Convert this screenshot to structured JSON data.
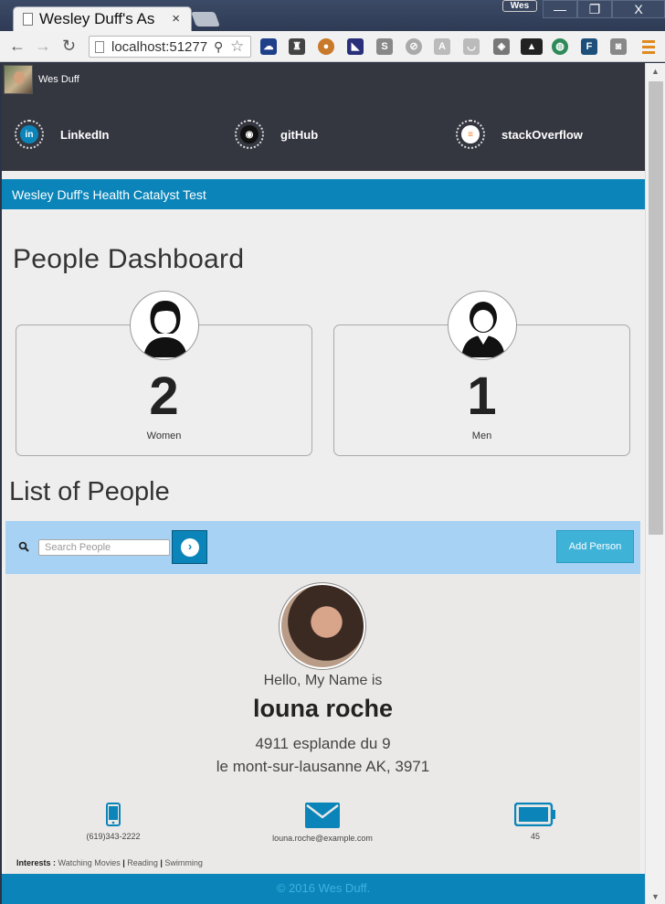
{
  "browser": {
    "tab_title": "Wesley Duff's As",
    "tab_close": "×",
    "profile_badge": "Wes",
    "url": "localhost:51277",
    "win_min": "—",
    "win_max": "❐",
    "win_close": "X"
  },
  "header": {
    "user_name": "Wes Duff",
    "social": [
      {
        "label": "LinkedIn",
        "icon": "linkedin-icon",
        "glyph": "in",
        "color": "#0b85b9"
      },
      {
        "label": "gitHub",
        "icon": "github-icon",
        "glyph": "◉",
        "color": "#111111"
      },
      {
        "label": "stackOverflow",
        "icon": "stackoverflow-icon",
        "glyph": "≡",
        "color": "#f48024"
      }
    ]
  },
  "banner": {
    "title": "Wesley Duff's Health Catalyst Test"
  },
  "dashboard": {
    "title": "People Dashboard",
    "stats": [
      {
        "count": "2",
        "label": "Women",
        "icon": "woman-icon"
      },
      {
        "count": "1",
        "label": "Men",
        "icon": "man-icon"
      }
    ]
  },
  "list": {
    "title": "List of People",
    "search_placeholder": "Search People",
    "go_glyph": "›",
    "add_label": "Add Person"
  },
  "person": {
    "greeting": "Hello, My Name is",
    "name": "louna roche",
    "address_line1": "4911 esplande du 9",
    "address_line2": "le mont-sur-lausanne AK, 3971",
    "phone": "(619)343-2222",
    "email": "louna.roche@example.com",
    "age": "45",
    "interests_label": "Interests :",
    "interests": [
      "Watching Movies",
      "Reading",
      "Swimming"
    ],
    "separator": "|"
  },
  "footer": {
    "text": "© 2016 Wes Duff."
  },
  "colors": {
    "accent": "#0b85b9",
    "header_bg": "#343640",
    "search_bg": "#a7d2f3"
  }
}
